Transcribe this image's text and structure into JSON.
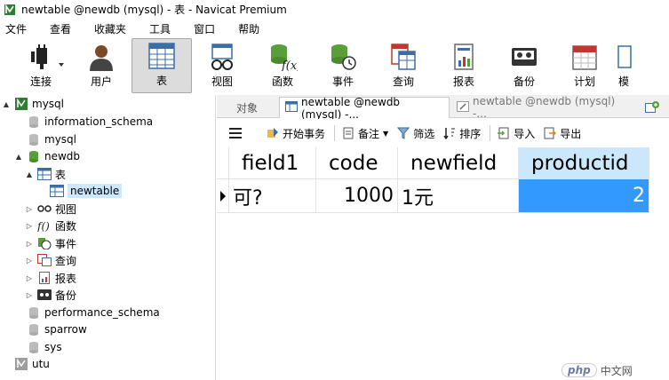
{
  "window": {
    "title": "newtable @newdb (mysql) - 表 - Navicat Premium"
  },
  "menu": [
    "文件",
    "查看",
    "收藏夹",
    "工具",
    "窗口",
    "帮助"
  ],
  "toolbar": [
    {
      "label": "连接",
      "icon": "plug-icon"
    },
    {
      "label": "用户",
      "icon": "user-icon"
    },
    {
      "label": "表",
      "icon": "table-icon",
      "active": true
    },
    {
      "label": "视图",
      "icon": "view-icon"
    },
    {
      "label": "函数",
      "icon": "function-icon"
    },
    {
      "label": "事件",
      "icon": "event-icon"
    },
    {
      "label": "查询",
      "icon": "query-icon"
    },
    {
      "label": "报表",
      "icon": "report-icon"
    },
    {
      "label": "备份",
      "icon": "backup-icon"
    },
    {
      "label": "计划",
      "icon": "schedule-icon"
    },
    {
      "label": "模",
      "icon": "model-icon"
    }
  ],
  "tree": [
    {
      "label": "mysql",
      "icon": "connection-icon",
      "expander": "▲",
      "level": 0
    },
    {
      "label": "information_schema",
      "icon": "database-icon",
      "expander": "",
      "level": 1
    },
    {
      "label": "mysql",
      "icon": "database-icon",
      "expander": "",
      "level": 1
    },
    {
      "label": "newdb",
      "icon": "database-open-icon",
      "expander": "▲",
      "level": 1
    },
    {
      "label": "表",
      "icon": "table-folder-icon",
      "expander": "▲",
      "level": 2
    },
    {
      "label": "newtable",
      "icon": "table-icon",
      "expander": "",
      "level": 3,
      "selected": true
    },
    {
      "label": "视图",
      "icon": "view-icon",
      "expander": "▷",
      "level": 2
    },
    {
      "label": "函数",
      "icon": "function-icon",
      "expander": "▷",
      "level": 2
    },
    {
      "label": "事件",
      "icon": "event-icon",
      "expander": "▷",
      "level": 2
    },
    {
      "label": "查询",
      "icon": "query-icon",
      "expander": "▷",
      "level": 2
    },
    {
      "label": "报表",
      "icon": "report-icon",
      "expander": "▷",
      "level": 2
    },
    {
      "label": "备份",
      "icon": "backup-icon",
      "expander": "▷",
      "level": 2
    },
    {
      "label": "performance_schema",
      "icon": "database-icon",
      "expander": "",
      "level": 1
    },
    {
      "label": "sparrow",
      "icon": "database-icon",
      "expander": "",
      "level": 1
    },
    {
      "label": "sys",
      "icon": "database-icon",
      "expander": "",
      "level": 1
    },
    {
      "label": "utu",
      "icon": "connection-icon",
      "expander": "",
      "level": 0
    }
  ],
  "tabs": {
    "objects": "对象",
    "active": "newtable @newdb (mysql) -...",
    "inactive": "newtable @newdb (mysql) -...",
    "new_tab_icon": "new-tab-icon"
  },
  "subtoolbar": {
    "menu_icon": "hamburger-icon",
    "begin_transaction": "开始事务",
    "notes": "备注",
    "filter": "筛选",
    "sort": "排序",
    "import": "导入",
    "export": "导出"
  },
  "grid": {
    "columns": [
      "field1",
      "code",
      "newfield",
      "productid"
    ],
    "rows": [
      [
        "可?",
        "1000",
        "1元",
        "2"
      ]
    ]
  },
  "watermark": {
    "logo": "php",
    "text": "中文网"
  }
}
